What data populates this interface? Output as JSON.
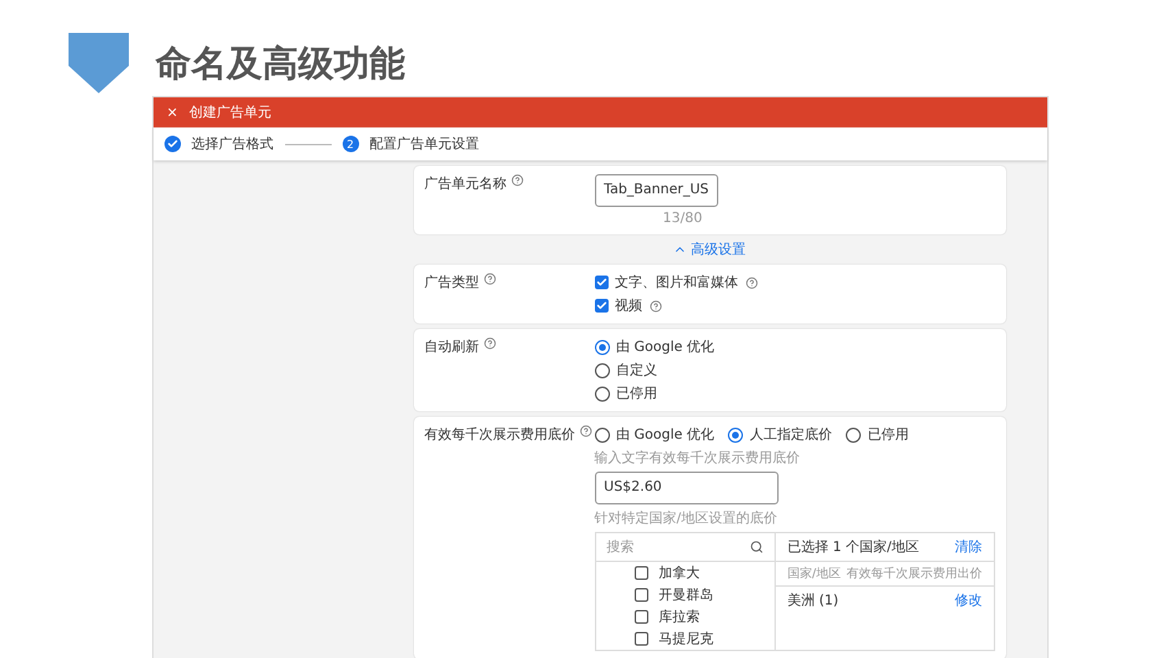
{
  "slide": {
    "title": "命名及高级功能"
  },
  "window": {
    "close": "×",
    "title": "创建广告单元"
  },
  "steps": [
    {
      "label": "选择广告格式",
      "done": true
    },
    {
      "label": "配置广告单元设置",
      "done": false,
      "number": "2"
    }
  ],
  "name_card": {
    "label": "广告单元名称",
    "value": "Tab_Banner_US",
    "counter": "13/80"
  },
  "advanced_link": "高级设置",
  "ad_type": {
    "label": "广告类型",
    "options": [
      {
        "label": "文字、图片和富媒体",
        "checked": true,
        "help": true
      },
      {
        "label": "视频",
        "checked": true,
        "help": true
      }
    ]
  },
  "auto_refresh": {
    "label": "自动刷新",
    "options": [
      {
        "label": "由 Google 优化",
        "selected": true
      },
      {
        "label": "自定义",
        "selected": false
      },
      {
        "label": "已停用",
        "selected": false
      }
    ]
  },
  "cpm": {
    "label": "有效每千次展示费用底价",
    "options": [
      {
        "label": "由 Google 优化",
        "selected": false
      },
      {
        "label": "人工指定底价",
        "selected": true
      },
      {
        "label": "已停用",
        "selected": false
      }
    ],
    "input_hint": "输入文字有效每千次展示费用底价",
    "value": "US$2.60",
    "region_hint": "针对特定国家/地区设置的底价",
    "search_placeholder": "搜索",
    "countries": [
      {
        "label": "加拿大",
        "checked": false
      },
      {
        "label": "开曼群岛",
        "checked": false
      },
      {
        "label": "库拉索",
        "checked": false
      },
      {
        "label": "马提尼克",
        "checked": false
      }
    ],
    "selected_header": "已选择 1 个国家/地区",
    "clear": "清除",
    "columns": [
      "国家/地区",
      "有效每千次展示费用出价"
    ],
    "group": {
      "label": "美洲 (1)",
      "action": "修改"
    }
  }
}
